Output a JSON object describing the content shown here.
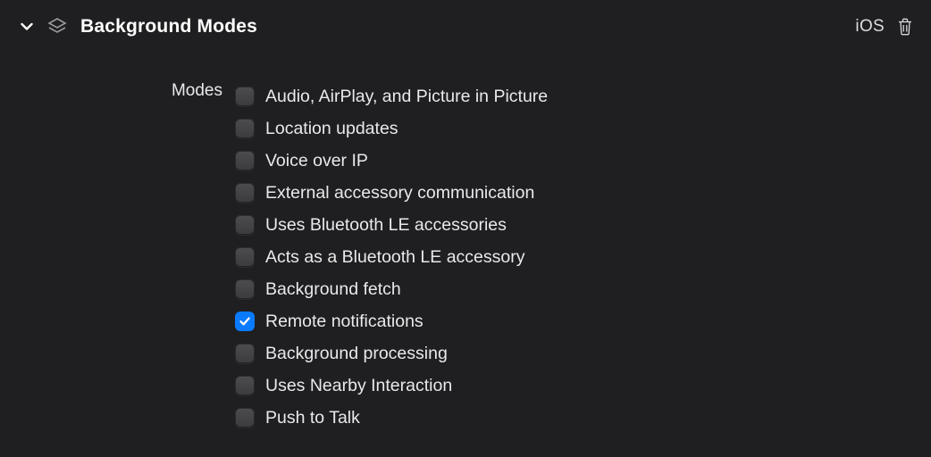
{
  "capability": {
    "title": "Background Modes",
    "platform": "iOS",
    "section_label": "Modes",
    "modes": [
      {
        "label": "Audio, AirPlay, and Picture in Picture",
        "checked": false
      },
      {
        "label": "Location updates",
        "checked": false
      },
      {
        "label": "Voice over IP",
        "checked": false
      },
      {
        "label": "External accessory communication",
        "checked": false
      },
      {
        "label": "Uses Bluetooth LE accessories",
        "checked": false
      },
      {
        "label": "Acts as a Bluetooth LE accessory",
        "checked": false
      },
      {
        "label": "Background fetch",
        "checked": false
      },
      {
        "label": "Remote notifications",
        "checked": true
      },
      {
        "label": "Background processing",
        "checked": false
      },
      {
        "label": "Uses Nearby Interaction",
        "checked": false
      },
      {
        "label": "Push to Talk",
        "checked": false
      }
    ]
  }
}
